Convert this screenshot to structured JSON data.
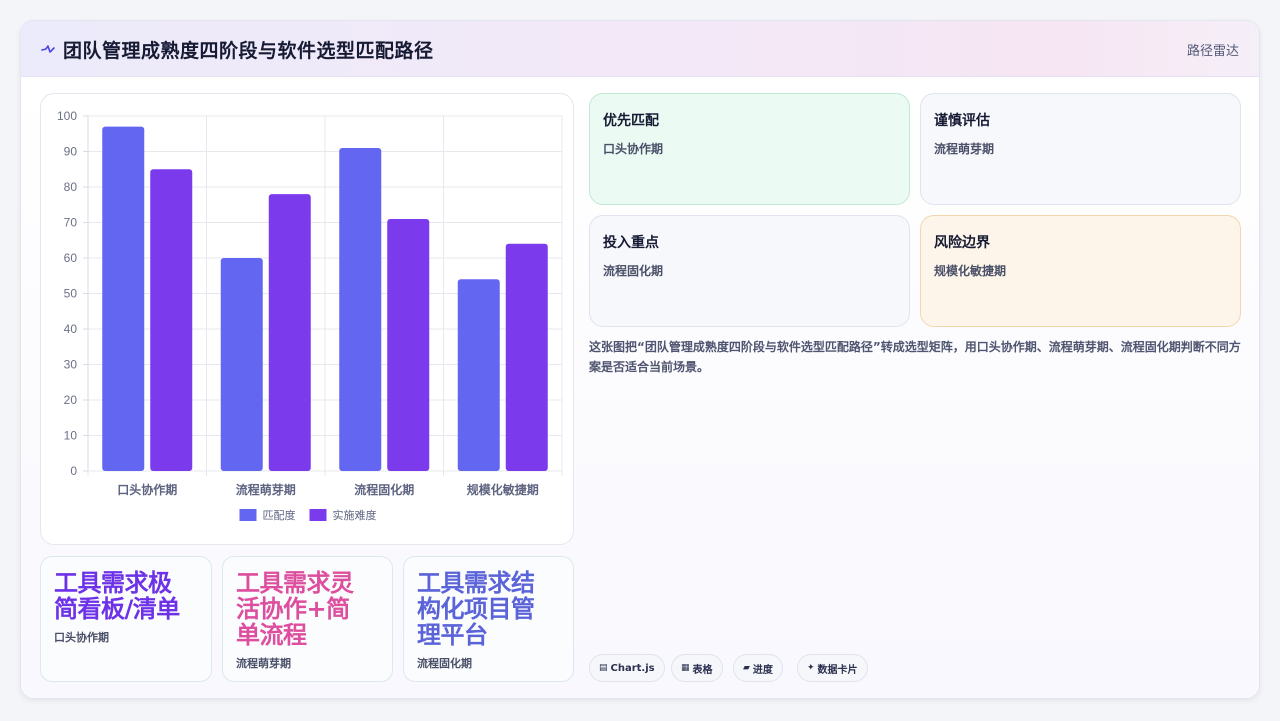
{
  "header": {
    "title": "团队管理成熟度四阶段与软件选型匹配路径",
    "tag": "路径雷达"
  },
  "chart_data": {
    "type": "bar",
    "categories": [
      "口头协作期",
      "流程萌芽期",
      "流程固化期",
      "规模化敏捷期"
    ],
    "series": [
      {
        "name": "匹配度",
        "values": [
          97,
          60,
          91,
          54
        ],
        "color": "#6366f1"
      },
      {
        "name": "实施难度",
        "values": [
          85,
          78,
          71,
          64
        ],
        "color": "#7c3aed"
      }
    ],
    "ylim": [
      0,
      100
    ],
    "yticks": [
      0,
      10,
      20,
      30,
      40,
      50,
      60,
      70,
      80,
      90,
      100
    ],
    "legend": "bottom",
    "grid": true
  },
  "mini_cards": [
    {
      "text": "工具需求极简看板/清单",
      "lines": [
        "工具需求极",
        "简看板/清单"
      ],
      "sub": "口头协作期",
      "color": "#6d32e8"
    },
    {
      "text": "工具需求灵活协作+简单流程",
      "lines": [
        "工具需求灵",
        "活协作+简",
        "单流程"
      ],
      "sub": "流程萌芽期",
      "color": "#dd4e9e"
    },
    {
      "text": "工具需求结构化项目管理平台",
      "lines": [
        "工具需求结",
        "构化项目管",
        "理平台"
      ],
      "sub": "流程固化期",
      "color": "#5b63d8"
    }
  ],
  "quadrants": [
    {
      "heading": "优先匹配",
      "text": "口头协作期",
      "bg": "#ebfaf3",
      "border": "#bfe9d3"
    },
    {
      "heading": "谨慎评估",
      "text": "流程萌芽期",
      "bg": "#f7f8fc",
      "border": "#e0e4ef"
    },
    {
      "heading": "投入重点",
      "text": "流程固化期",
      "bg": "#f7f8fc",
      "border": "#e0e4ef"
    },
    {
      "heading": "风险边界",
      "text": "规模化敏捷期",
      "bg": "#fdf5e9",
      "border": "#f2d7ae"
    }
  ],
  "description": "这张图把“团队管理成熟度四阶段与软件选型匹配路径”转成选型矩阵，用口头协作期、流程萌芽期、流程固化期判断不同方案是否适合当前场景。",
  "chips": [
    {
      "icon": "▤",
      "label": "Chart.js"
    },
    {
      "icon": "▦",
      "label": "表格"
    },
    {
      "icon": "▰",
      "label": "进度"
    },
    {
      "icon": "✦",
      "label": "数据卡片"
    }
  ]
}
